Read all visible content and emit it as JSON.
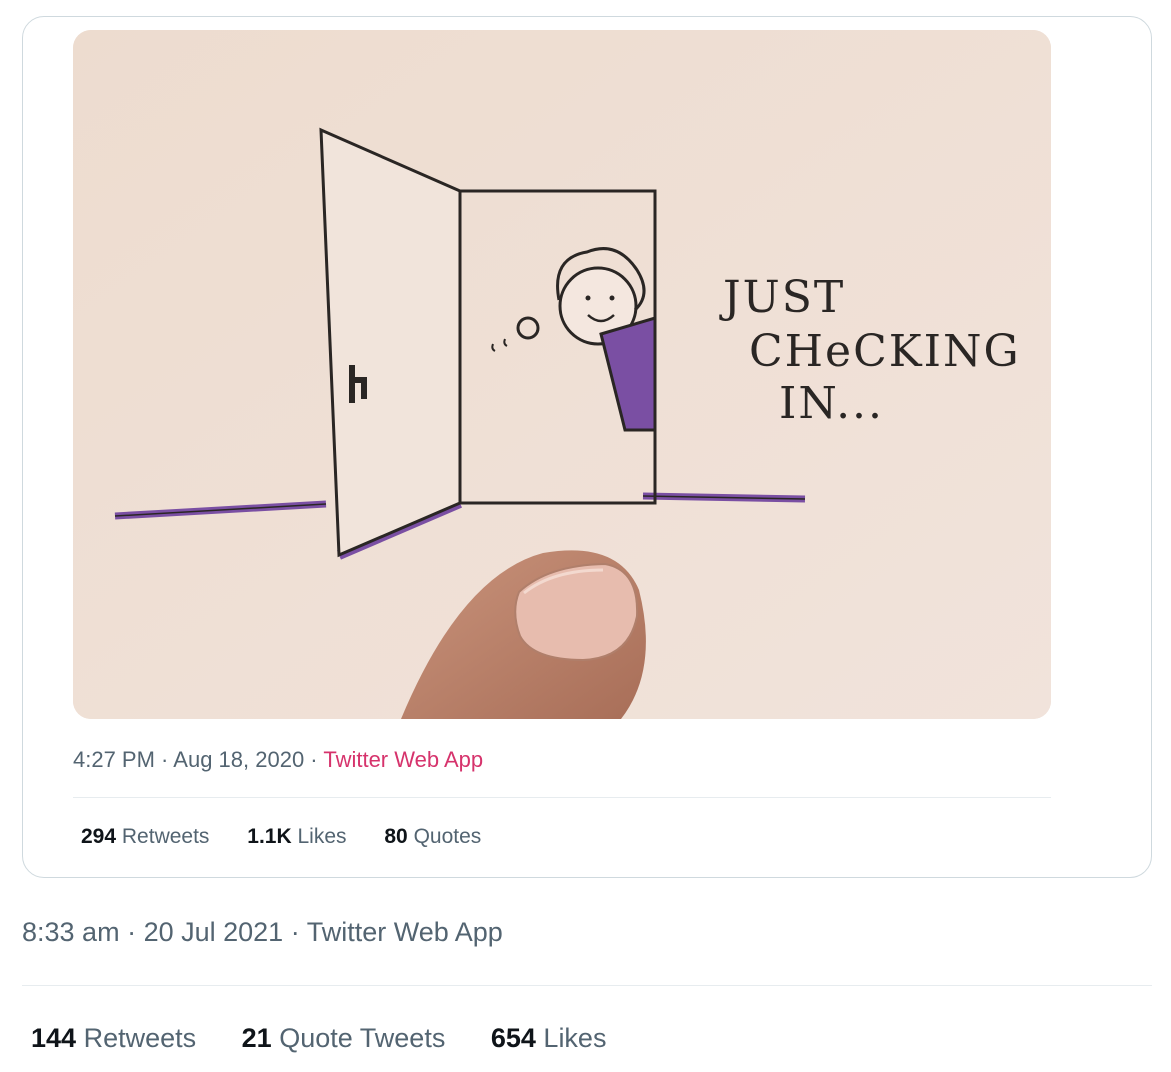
{
  "quoted_tweet": {
    "image": {
      "lines": [
        "JUST",
        "CHeCKING",
        "IN..."
      ],
      "accent_color": "#7a4fa3"
    },
    "meta": {
      "time": "4:27 PM",
      "separator": " · ",
      "date": "Aug 18, 2020",
      "source": "Twitter Web App",
      "source_color": "#d6336c"
    },
    "stats": {
      "retweets_count": "294",
      "retweets_label": "Retweets",
      "likes_count": "1.1K",
      "likes_label": "Likes",
      "quotes_count": "80",
      "quotes_label": "Quotes"
    }
  },
  "tweet": {
    "meta": {
      "time": "8:33 am",
      "separator": " · ",
      "date": "20 Jul 2021",
      "source": "Twitter Web App"
    },
    "stats": {
      "retweets_count": "144",
      "retweets_label": "Retweets",
      "quote_tweets_count": "21",
      "quote_tweets_label": "Quote Tweets",
      "likes_count": "654",
      "likes_label": "Likes"
    }
  }
}
